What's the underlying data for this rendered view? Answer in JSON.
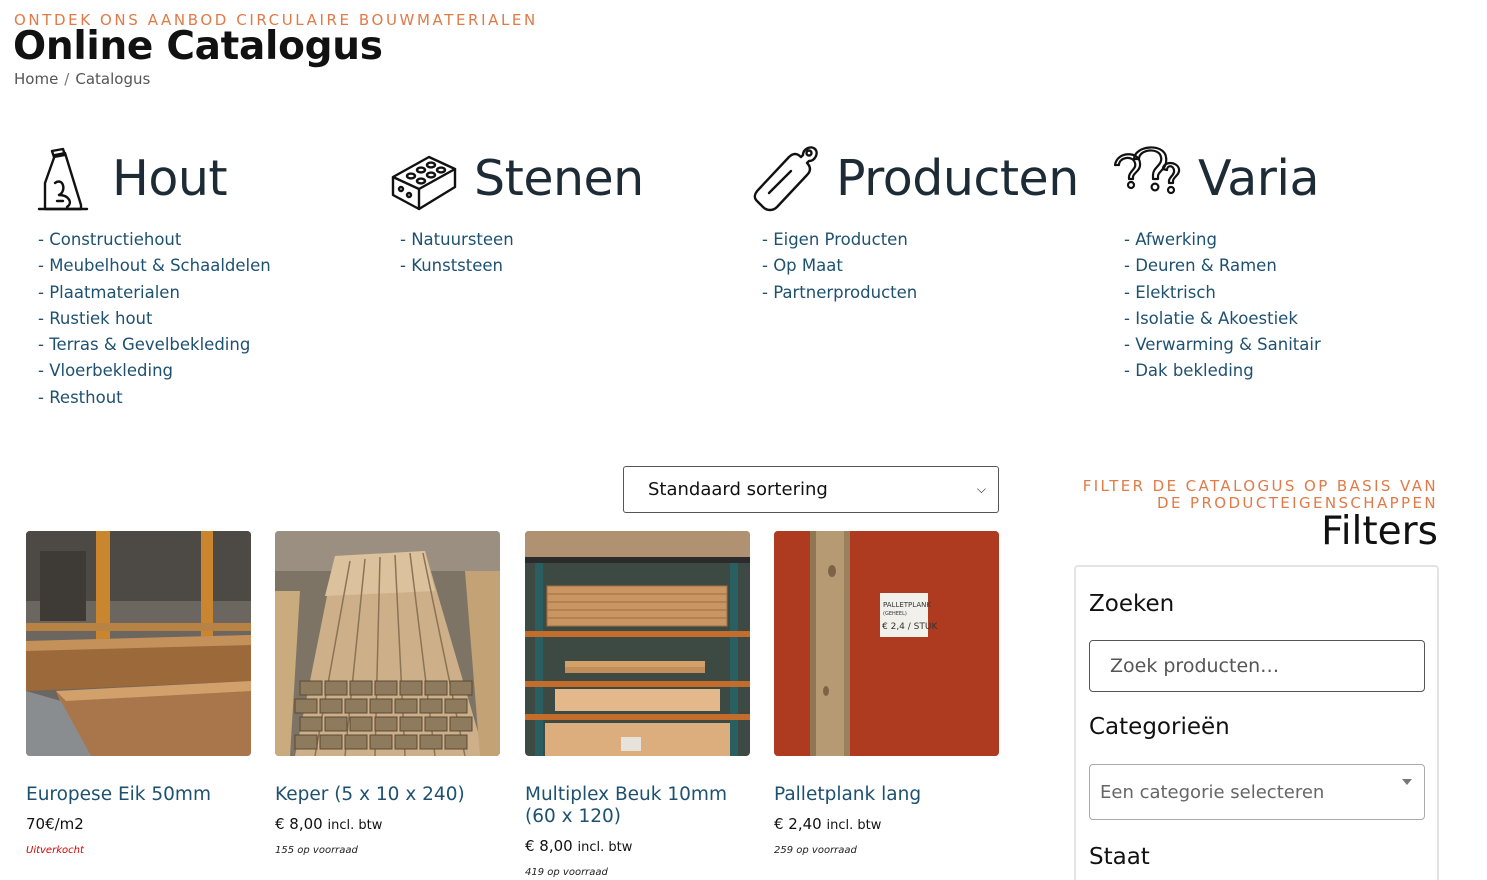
{
  "header": {
    "eyebrow": "ONTDEK ONS AANBOD CIRCULAIRE BOUWMATERIALEN",
    "title": "Online Catalogus",
    "breadcrumb": {
      "home": "Home",
      "separator": "/",
      "current": "Catalogus"
    }
  },
  "categories": [
    {
      "title": "Hout",
      "icon": "wood-log-icon",
      "items": [
        "- Constructiehout",
        "- Meubelhout & Schaaldelen",
        "- Plaatmaterialen",
        "- Rustiek hout",
        "- Terras & Gevelbekleding",
        "- Vloerbekleding",
        "- Resthout"
      ]
    },
    {
      "title": "Stenen",
      "icon": "brick-icon",
      "items": [
        "- Natuursteen",
        "- Kunststeen"
      ]
    },
    {
      "title": "Producten",
      "icon": "cutting-board-icon",
      "items": [
        "- Eigen Producten",
        "- Op Maat",
        "- Partnerproducten"
      ]
    },
    {
      "title": "Varia",
      "icon": "question-marks-icon",
      "items": [
        "- Afwerking",
        "- Deuren & Ramen",
        "- Elektrisch",
        "- Isolatie & Akoestiek",
        "- Verwarming & Sanitair",
        "- Dak bekleding"
      ]
    }
  ],
  "sorting": {
    "selected": "Standaard sortering"
  },
  "products": [
    {
      "name": "Europese Eik 50mm",
      "price": "70€/m2",
      "tax": "",
      "stock": "Uitverkocht",
      "out_of_stock": true
    },
    {
      "name": "Keper (5 x 10 x 240)",
      "price": "€ 8,00",
      "tax": "incl. btw",
      "stock": "155 op voorraad",
      "out_of_stock": false
    },
    {
      "name": "Multiplex Beuk 10mm (60 x 120)",
      "price": "€ 8,00",
      "tax": "incl. btw",
      "stock": "419 op voorraad",
      "out_of_stock": false
    },
    {
      "name": "Palletplank lang",
      "price": "€ 2,40",
      "tax": "incl. btw",
      "stock": "259 op voorraad",
      "out_of_stock": false
    }
  ],
  "product_image_text": {
    "sign_line1": "PALLETPLANK",
    "sign_line2": "(GEHEEL)",
    "sign_line3": "€ 2,4 / STUK"
  },
  "filters": {
    "eyebrow": "FILTER DE CATALOGUS OP BASIS VAN DE PRODUCTEIGENSCHAPPEN",
    "title": "Filters",
    "search_heading": "Zoeken",
    "search_placeholder": "Zoek producten…",
    "categories_heading": "Categorieën",
    "categories_placeholder": "Een categorie selecteren",
    "state_heading": "Staat"
  },
  "colors": {
    "accent": "#e07a48",
    "link": "#1e5170",
    "out_of_stock": "#d40000"
  }
}
